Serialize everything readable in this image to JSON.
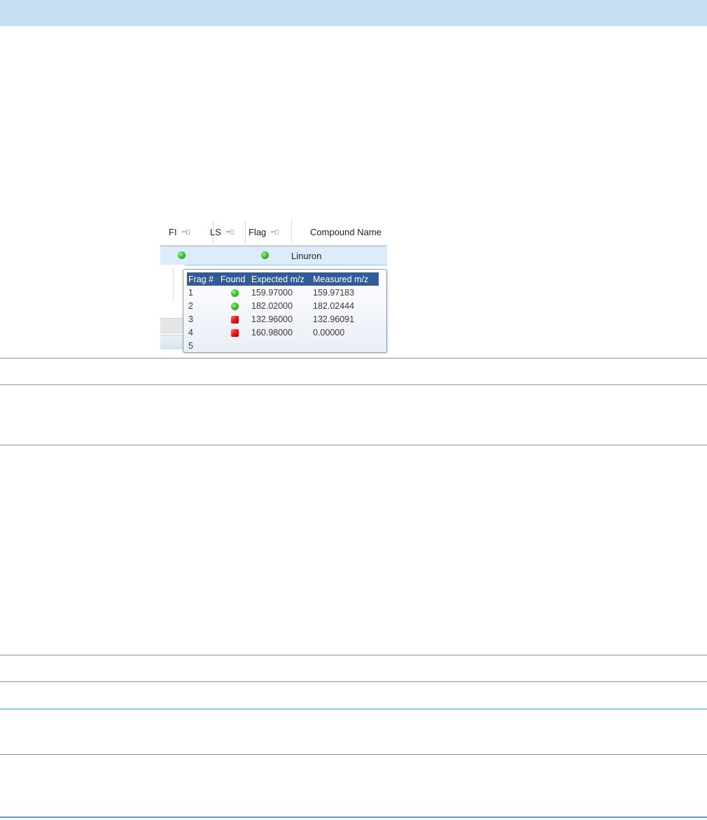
{
  "colors": {
    "top_band": "#c5dff5",
    "rule": "#5b9bd5",
    "header_fill": "#2f5c9b",
    "found": "#3fc12f",
    "missing": "#e31b1b"
  },
  "grid": {
    "columns": [
      {
        "label": "FI"
      },
      {
        "label": "LS"
      },
      {
        "label": "Flag"
      },
      {
        "label": "Compound Name"
      }
    ],
    "row": {
      "fi_icon": "green-dot-icon",
      "flag_icon": "green-dot-icon",
      "compound_name": "Linuron"
    }
  },
  "tooltip": {
    "headers": {
      "frag": "Frag #",
      "found": "Found",
      "expected": "Expected m/z",
      "measured": "Measured m/z"
    },
    "rows": [
      {
        "frag": "1",
        "found": "found",
        "expected": "159.97000",
        "measured": "159.97183"
      },
      {
        "frag": "2",
        "found": "found",
        "expected": "182.02000",
        "measured": "182.02444"
      },
      {
        "frag": "3",
        "found": "missing",
        "expected": "132.96000",
        "measured": "132.96091"
      },
      {
        "frag": "4",
        "found": "missing",
        "expected": "160.98000",
        "measured": "0.00000"
      },
      {
        "frag": "5",
        "found": "",
        "expected": "",
        "measured": ""
      }
    ]
  }
}
